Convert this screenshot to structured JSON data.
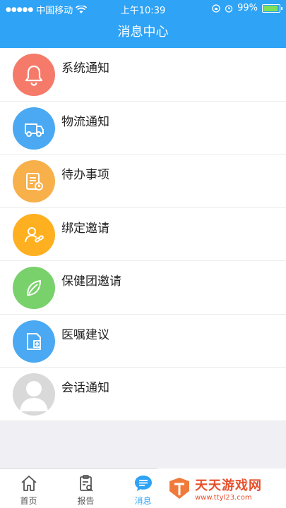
{
  "status_bar": {
    "carrier": "中国移动",
    "time": "上午10:39",
    "battery": "99%",
    "battery_level": 0.99
  },
  "header": {
    "title": "消息中心"
  },
  "items": [
    {
      "label": "系统通知",
      "color": "#f57a6a",
      "icon": "bell-icon"
    },
    {
      "label": "物流通知",
      "color": "#4aa9f2",
      "icon": "truck-icon"
    },
    {
      "label": "待办事项",
      "color": "#f7b04a",
      "icon": "todo-list-icon"
    },
    {
      "label": "绑定邀请",
      "color": "#ffb020",
      "icon": "user-link-icon"
    },
    {
      "label": "保健团邀请",
      "color": "#79d16b",
      "icon": "leaf-icon"
    },
    {
      "label": "医嘱建议",
      "color": "#4aa9f2",
      "icon": "document-add-icon"
    },
    {
      "label": "会话通知",
      "color": "#d9d9d9",
      "icon": "person-silhouette-icon"
    }
  ],
  "tabs": [
    {
      "label": "首页",
      "icon": "home-icon",
      "active": false
    },
    {
      "label": "报告",
      "icon": "report-icon",
      "active": false
    },
    {
      "label": "消息",
      "icon": "message-icon",
      "active": true
    }
  ],
  "watermark": {
    "title": "天天游戏网",
    "url": "www.ttyl23.com"
  },
  "colors": {
    "accent": "#2fa3f6",
    "background": "#efeff4"
  }
}
